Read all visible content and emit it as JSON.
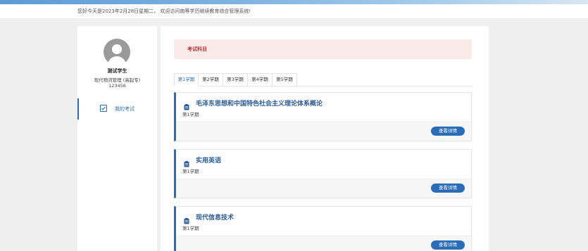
{
  "header": {
    "greeting": "您好今天是2023年2月28日星期二， 欢迎访问南等学历继续教育综合管理系统!"
  },
  "sidebar": {
    "user_name": "测试学生",
    "user_major": "现代物流管理 (高起专)",
    "user_id": "123456",
    "menu": [
      {
        "label": "我的考试",
        "icon": "calendar-check-icon",
        "active": true
      }
    ]
  },
  "main": {
    "section_title": "考试科目",
    "tabs": [
      {
        "label": "第1学期",
        "active": true
      },
      {
        "label": "第2学期",
        "active": false
      },
      {
        "label": "第3学期",
        "active": false
      },
      {
        "label": "第4学期",
        "active": false
      },
      {
        "label": "第5学期",
        "active": false
      }
    ],
    "courses": [
      {
        "title": "毛泽东思想和中国特色社会主义理论体系概论",
        "term": "第1学期",
        "button": "查看详情"
      },
      {
        "title": "实用英语",
        "term": "第1学期",
        "button": "查看详情"
      },
      {
        "title": "现代信息技术",
        "term": "第1学期",
        "button": "查看详情"
      }
    ]
  },
  "colors": {
    "accent": "#2a6cb5",
    "section_bg": "#fbeaea",
    "section_text": "#b23a3a"
  }
}
